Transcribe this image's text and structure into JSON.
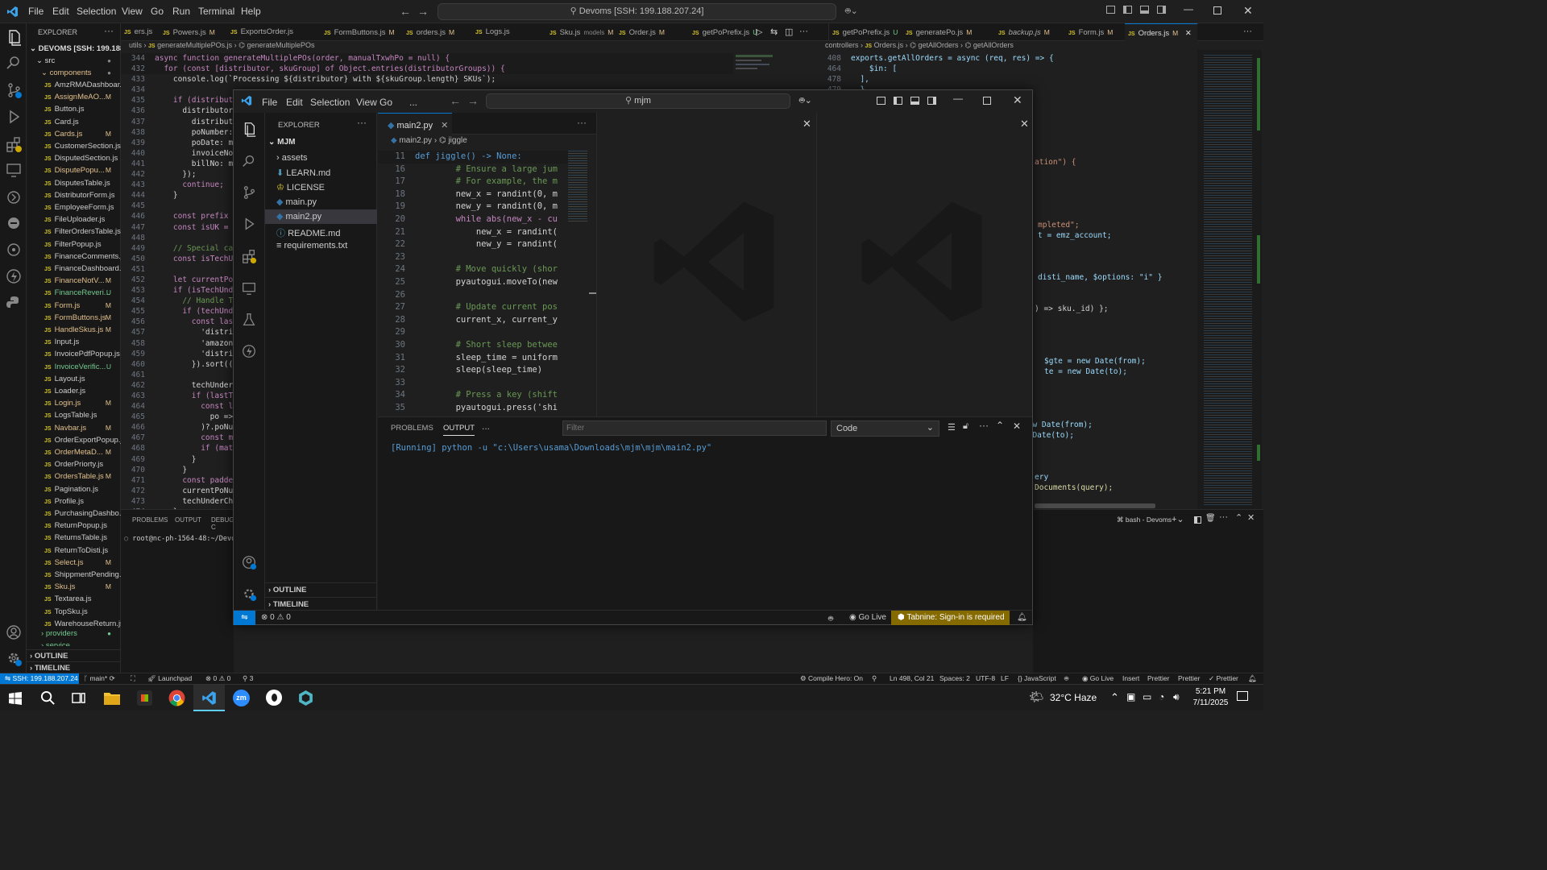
{
  "window": {
    "menu": [
      "File",
      "Edit",
      "Selection",
      "View",
      "Go",
      "Run",
      "Terminal",
      "Help"
    ],
    "command_center": "Devoms [SSH: 199.188.207.24]"
  },
  "explorer": {
    "header": "EXPLORER",
    "root": "DEVOMS [SSH: 199.188.20...",
    "folders": {
      "src": "src",
      "components": "components",
      "providers": "providers",
      "service": "service"
    },
    "files": [
      {
        "name": "AmzRMADashboar...",
        "status": ""
      },
      {
        "name": "AssignMeAO...",
        "status": "M"
      },
      {
        "name": "Button.js",
        "status": ""
      },
      {
        "name": "Card.js",
        "status": ""
      },
      {
        "name": "Cards.js",
        "status": "M"
      },
      {
        "name": "CustomerSection.js",
        "status": ""
      },
      {
        "name": "DisputedSection.js",
        "status": ""
      },
      {
        "name": "DisputePopu...",
        "status": "M"
      },
      {
        "name": "DisputesTable.js",
        "status": ""
      },
      {
        "name": "DistributorForm.js",
        "status": ""
      },
      {
        "name": "EmployeeForm.js",
        "status": ""
      },
      {
        "name": "FileUploader.js",
        "status": ""
      },
      {
        "name": "FilterOrdersTable.js",
        "status": ""
      },
      {
        "name": "FilterPopup.js",
        "status": ""
      },
      {
        "name": "FinanceComments.js",
        "status": ""
      },
      {
        "name": "FinanceDashboard.js",
        "status": ""
      },
      {
        "name": "FinanceNotV...",
        "status": "M"
      },
      {
        "name": "FinanceReveri...",
        "status": "U"
      },
      {
        "name": "Form.js",
        "status": "M"
      },
      {
        "name": "FormButtons.js",
        "status": "M"
      },
      {
        "name": "HandleSkus.js",
        "status": "M"
      },
      {
        "name": "Input.js",
        "status": ""
      },
      {
        "name": "InvoicePdfPopup.js",
        "status": ""
      },
      {
        "name": "InvoiceVerific...",
        "status": "U"
      },
      {
        "name": "Layout.js",
        "status": ""
      },
      {
        "name": "Loader.js",
        "status": ""
      },
      {
        "name": "Login.js",
        "status": "M"
      },
      {
        "name": "LogsTable.js",
        "status": ""
      },
      {
        "name": "Navbar.js",
        "status": "M"
      },
      {
        "name": "OrderExportPopup.js",
        "status": ""
      },
      {
        "name": "OrderMetaD...",
        "status": "M"
      },
      {
        "name": "OrderPriorty.js",
        "status": ""
      },
      {
        "name": "OrdersTable.js",
        "status": "M"
      },
      {
        "name": "Pagination.js",
        "status": ""
      },
      {
        "name": "Profile.js",
        "status": ""
      },
      {
        "name": "PurchasingDashbo...",
        "status": ""
      },
      {
        "name": "ReturnPopup.js",
        "status": ""
      },
      {
        "name": "ReturnsTable.js",
        "status": ""
      },
      {
        "name": "ReturnToDisti.js",
        "status": ""
      },
      {
        "name": "Select.js",
        "status": "M"
      },
      {
        "name": "ShippmentPending...",
        "status": ""
      },
      {
        "name": "Sku.js",
        "status": "M"
      },
      {
        "name": "Textarea.js",
        "status": ""
      },
      {
        "name": "TopSku.js",
        "status": ""
      },
      {
        "name": "WarehouseReturn.js",
        "status": ""
      }
    ],
    "outline": "OUTLINE",
    "timeline": "TIMELINE"
  },
  "tabs": [
    {
      "label": "ers.js",
      "status": ""
    },
    {
      "label": "Powers.js",
      "status": "M"
    },
    {
      "label": "ExportsOrder.js",
      "status": ""
    },
    {
      "label": "FormButtons.js",
      "status": "M"
    },
    {
      "label": "orders.js",
      "status": "M"
    },
    {
      "label": "Logs.js",
      "status": ""
    },
    {
      "label": "Sku.js",
      "status": "M",
      "extra": "models"
    },
    {
      "label": "Order.js",
      "status": "M"
    },
    {
      "label": "getPoPrefix.js",
      "status": "U"
    },
    {
      "label": "getPoPrefix.js",
      "status": "U"
    },
    {
      "label": "generatePo.js",
      "status": "M"
    },
    {
      "label": "backup.js",
      "status": "M"
    },
    {
      "label": "Form.js",
      "status": "M"
    },
    {
      "label": "Orders.js",
      "status": "M"
    }
  ],
  "left_editor": {
    "breadcrumb": [
      "utils",
      "generateMultiplePOs.js",
      "generateMultiplePOs"
    ],
    "sticky": [
      {
        "n": "344",
        "t": "async function generateMultiplePOs(order, manualTxwhPo = null) {"
      },
      {
        "n": "432",
        "t": "  for (const [distributor, skuGroup] of Object.entries(distributorGroups)) {"
      }
    ],
    "lines": [
      {
        "n": "433",
        "t": "    console.log(`Processing ${distributor} with ${skuGroup.length} SKUs`);"
      },
      {
        "n": "434",
        "t": ""
      },
      {
        "n": "435",
        "t": "    if (distributo"
      },
      {
        "n": "436",
        "t": "      distributorI"
      },
      {
        "n": "437",
        "t": "        distribut"
      },
      {
        "n": "438",
        "t": "        poNumber:"
      },
      {
        "n": "439",
        "t": "        poDate: ma"
      },
      {
        "n": "440",
        "t": "        invoiceNo"
      },
      {
        "n": "441",
        "t": "        billNo: m"
      },
      {
        "n": "442",
        "t": "      });"
      },
      {
        "n": "443",
        "t": "      continue;"
      },
      {
        "n": "444",
        "t": "    }"
      },
      {
        "n": "445",
        "t": ""
      },
      {
        "n": "446",
        "t": "    const prefix ="
      },
      {
        "n": "447",
        "t": "    const isUK ="
      },
      {
        "n": "448",
        "t": ""
      },
      {
        "n": "449",
        "t": "    // Special cas"
      },
      {
        "n": "450",
        "t": "    const isTechU"
      },
      {
        "n": "451",
        "t": ""
      },
      {
        "n": "452",
        "t": "    let currentPo"
      },
      {
        "n": "453",
        "t": "    if (isTechUnd"
      },
      {
        "n": "454",
        "t": "      // Handle Te"
      },
      {
        "n": "455",
        "t": "      if (techUnd"
      },
      {
        "n": "456",
        "t": "        const last"
      },
      {
        "n": "457",
        "t": "          'distri"
      },
      {
        "n": "458",
        "t": "          'amazon"
      },
      {
        "n": "459",
        "t": "          'distri"
      },
      {
        "n": "460",
        "t": "        }).sort(("
      },
      {
        "n": "461",
        "t": ""
      },
      {
        "n": "462",
        "t": "        techUnder"
      },
      {
        "n": "463",
        "t": "        if (lastT"
      },
      {
        "n": "464",
        "t": "          const l"
      },
      {
        "n": "465",
        "t": "            po =>"
      },
      {
        "n": "466",
        "t": "          )?.poNu"
      },
      {
        "n": "467",
        "t": "          const m"
      },
      {
        "n": "468",
        "t": "          if (mat"
      },
      {
        "n": "469",
        "t": "        }"
      },
      {
        "n": "470",
        "t": "      }"
      },
      {
        "n": "471",
        "t": "      const padde"
      },
      {
        "n": "472",
        "t": "      currentPoNu"
      },
      {
        "n": "473",
        "t": "      techUnderCh"
      },
      {
        "n": "474",
        "t": "    }"
      }
    ]
  },
  "left_panel": {
    "tabs": [
      "PROBLEMS",
      "OUTPUT",
      "DEBUG C"
    ],
    "terminal_line": "root@nc-ph-1564-48:~/Devom"
  },
  "right_editor": {
    "breadcrumb": [
      "controllers",
      "Orders.js",
      "getAllOrders",
      "getAllOrders"
    ],
    "lines": [
      {
        "n": "408",
        "t": "exports.getAllOrders = async (req, res) => {"
      },
      {
        "n": "464",
        "t": "    $in: ["
      },
      {
        "n": "478",
        "t": "  ],"
      },
      {
        "n": "479",
        "t": "  },"
      }
    ],
    "fragments": [
      "ation\") {",
      "mpleted\";",
      "t = emz_account;",
      "disti_name, $options: \"i\" }",
      ") => sku._id) };",
      "$gte = new Date(from);",
      "te = new Date(to);",
      "new Date(from);",
      "w Date(to);",
      "ery",
      "Documents(query);"
    ],
    "terminal_tab": "bash - Devoms"
  },
  "overlay": {
    "menu": [
      "File",
      "Edit",
      "Selection",
      "View",
      "Go",
      "..."
    ],
    "search": "mjm",
    "explorer_header": "EXPLORER",
    "folder": "MJM",
    "items": [
      {
        "name": "assets",
        "type": "folder"
      },
      {
        "name": "LEARN.md",
        "type": "md"
      },
      {
        "name": "LICENSE",
        "type": "license"
      },
      {
        "name": "main.py",
        "type": "py"
      },
      {
        "name": "main2.py",
        "type": "py"
      },
      {
        "name": "README.md",
        "type": "info"
      },
      {
        "name": "requirements.txt",
        "type": "txt"
      }
    ],
    "outline": "OUTLINE",
    "timeline": "TIMELINE",
    "tab": "main2.py",
    "breadcrumb": [
      "main2.py",
      "jiggle"
    ],
    "sticky": {
      "n": "11",
      "t": "def jiggle() -> None:"
    },
    "lines": [
      {
        "n": "16",
        "t": "        # Ensure a large jum"
      },
      {
        "n": "17",
        "t": "        # For example, the m"
      },
      {
        "n": "18",
        "t": "        new_x = randint(0, m"
      },
      {
        "n": "19",
        "t": "        new_y = randint(0, m"
      },
      {
        "n": "20",
        "t": "        while abs(new_x - cu"
      },
      {
        "n": "21",
        "t": "            new_x = randint("
      },
      {
        "n": "22",
        "t": "            new_y = randint("
      },
      {
        "n": "23",
        "t": ""
      },
      {
        "n": "24",
        "t": "        # Move quickly (shor"
      },
      {
        "n": "25",
        "t": "        pyautogui.moveTo(new"
      },
      {
        "n": "26",
        "t": ""
      },
      {
        "n": "27",
        "t": "        # Update current pos"
      },
      {
        "n": "28",
        "t": "        current_x, current_y"
      },
      {
        "n": "29",
        "t": ""
      },
      {
        "n": "30",
        "t": "        # Short sleep betwee"
      },
      {
        "n": "31",
        "t": "        sleep_time = uniform"
      },
      {
        "n": "32",
        "t": "        sleep(sleep_time)"
      },
      {
        "n": "33",
        "t": ""
      },
      {
        "n": "34",
        "t": "        # Press a key (shift"
      },
      {
        "n": "35",
        "t": "        pyautogui.press('shi"
      }
    ],
    "panel_tabs": [
      "PROBLEMS",
      "OUTPUT",
      "..."
    ],
    "filter_placeholder": "Filter",
    "output_channel": "Code",
    "output_line": "[Running] python -u \"c:\\Users\\usama\\Downloads\\mjm\\mjm\\main2.py\"",
    "status": {
      "errors": "0",
      "warnings": "0",
      "golive": "Go Live",
      "tabnine": "Tabnine: Sign-in is required"
    }
  },
  "statusbar": {
    "remote": "SSH: 199.188.207.24",
    "branch": "main*",
    "launchpad": "Launchpad",
    "errors": "0",
    "warnings": "0",
    "ports": "3",
    "compile_hero": "Compile Hero: On",
    "position": "Ln 498, Col 21",
    "spaces": "Spaces: 2",
    "encoding": "UTF-8",
    "eol": "LF",
    "language": "JavaScript",
    "golive": "Go Live",
    "insert": "Insert",
    "prettier1": "Prettier",
    "prettier2": "Prettier",
    "prettier3": "Prettier"
  },
  "taskbar": {
    "weather": "32°C  Haze",
    "time": "5:21 PM",
    "date": "7/11/2025"
  },
  "colors": {
    "accent": "#0078d4",
    "tabnine": "#856a00",
    "js": "#d5c42a",
    "modified": "#e2c08d",
    "untracked": "#73c991"
  }
}
